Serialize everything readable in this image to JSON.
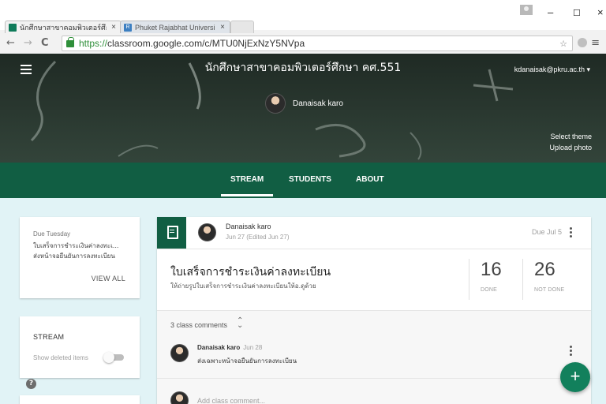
{
  "browser": {
    "tabs": [
      {
        "title": "นักศึกษาสาขาคอมพิวเตอร์ศึกษ",
        "favicon": "classroom-icon",
        "active": true
      },
      {
        "title": "Phuket Rajabhat Universi",
        "favicon": "pkru-icon",
        "active": false
      }
    ],
    "favicon_pkru_text": "R",
    "window_controls": {
      "minimize": "–",
      "maximize": "☐",
      "close": "×"
    },
    "url_scheme": "https://",
    "url_rest": "classroom.google.com/c/MTU0NjExNzY5NVpa"
  },
  "header": {
    "class_title": "นักศึกษาสาขาคอมพิวเตอร์ศึกษา คศ.551",
    "account": "kdanaisak@pkru.ac.th ▾",
    "teacher_name": "Danaisak karo",
    "select_theme": "Select theme",
    "upload_photo": "Upload photo",
    "colors": {
      "banner": "#213229",
      "tabs_bar": "#115e43",
      "accent": "#12805c"
    }
  },
  "nav_tabs": [
    {
      "label": "STREAM",
      "active": true
    },
    {
      "label": "STUDENTS",
      "active": false
    },
    {
      "label": "ABOUT",
      "active": false
    }
  ],
  "sidebar": {
    "due_label": "Due Tuesday",
    "due_items": [
      "ใบเสร็จการชำระเงินค่าลงทะเ...",
      "ส่งหน้าจอยืนยันการลงทะเบียน"
    ],
    "view_all": "VIEW ALL",
    "stream_label": "STREAM",
    "show_deleted": "Show deleted items",
    "show_deleted_on": false,
    "help": "?"
  },
  "post": {
    "author": "Danaisak karo",
    "date": "Jun 27 (Edited Jun 27)",
    "due": "Due Jul 5",
    "title": "ใบเสร็จการชำระเงินค่าลงทะเบียน",
    "description": "ให้ถ่ายรูปใบเสร็จการชำระเงินค่าลงทะเบียนให้อ.ดูด้วย",
    "done_count": "16",
    "done_label": "DONE",
    "not_done_count": "26",
    "not_done_label": "NOT DONE",
    "comment_count": "3 class comments",
    "comment": {
      "author": "Danaisak karo",
      "date": "Jun 28",
      "text": "ส่งเฉพาะหน้าจอยืนยันการลงทะเบียน"
    },
    "add_comment_placeholder": "Add class comment..."
  },
  "fab_label": "+"
}
